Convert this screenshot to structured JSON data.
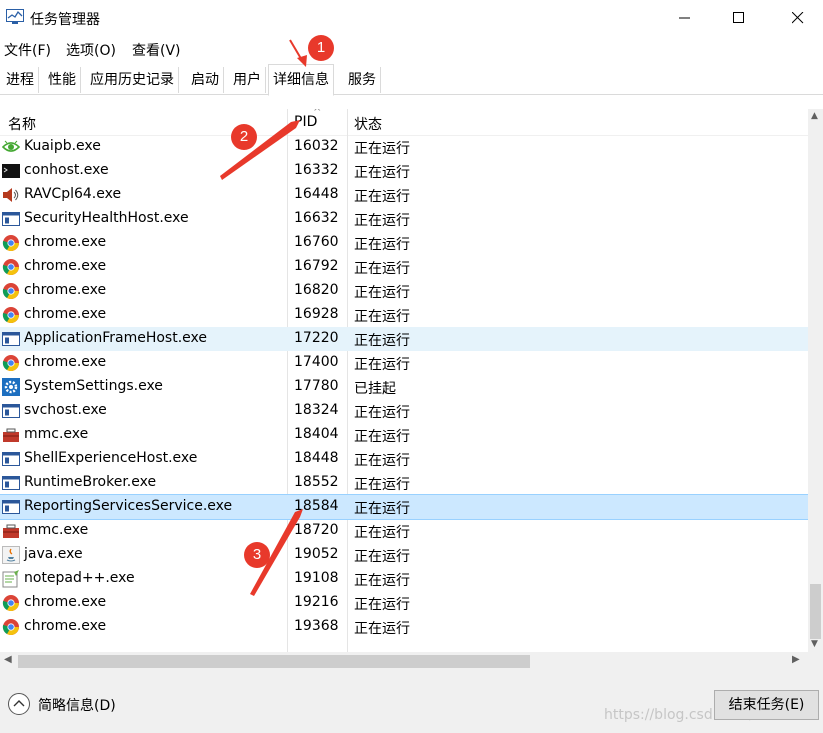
{
  "window": {
    "title": "任务管理器"
  },
  "menu": {
    "items": [
      "文件(F)",
      "选项(O)",
      "查看(V)"
    ]
  },
  "tabs": [
    "进程",
    "性能",
    "应用历史记录",
    "启动",
    "用户",
    "详细信息",
    "服务"
  ],
  "active_tab": "详细信息",
  "columns": {
    "name": "名称",
    "pid": "PID",
    "status": "状态"
  },
  "rows": [
    {
      "icon": "kuaipb-eye-icon",
      "name": "Kuaipb.exe",
      "pid": "16032",
      "status": "正在运行"
    },
    {
      "icon": "console-icon",
      "name": "conhost.exe",
      "pid": "16332",
      "status": "正在运行"
    },
    {
      "icon": "speaker-icon",
      "name": "RAVCpl64.exe",
      "pid": "16448",
      "status": "正在运行"
    },
    {
      "icon": "window-app-icon",
      "name": "SecurityHealthHost.exe",
      "pid": "16632",
      "status": "正在运行"
    },
    {
      "icon": "chrome-icon",
      "name": "chrome.exe",
      "pid": "16760",
      "status": "正在运行"
    },
    {
      "icon": "chrome-icon",
      "name": "chrome.exe",
      "pid": "16792",
      "status": "正在运行"
    },
    {
      "icon": "chrome-icon",
      "name": "chrome.exe",
      "pid": "16820",
      "status": "正在运行"
    },
    {
      "icon": "chrome-icon",
      "name": "chrome.exe",
      "pid": "16928",
      "status": "正在运行"
    },
    {
      "icon": "window-app-icon",
      "name": "ApplicationFrameHost.exe",
      "pid": "17220",
      "status": "正在运行"
    },
    {
      "icon": "chrome-icon",
      "name": "chrome.exe",
      "pid": "17400",
      "status": "正在运行"
    },
    {
      "icon": "gear-icon",
      "name": "SystemSettings.exe",
      "pid": "17780",
      "status": "已挂起"
    },
    {
      "icon": "window-app-icon",
      "name": "svchost.exe",
      "pid": "18324",
      "status": "正在运行"
    },
    {
      "icon": "toolbox-icon",
      "name": "mmc.exe",
      "pid": "18404",
      "status": "正在运行"
    },
    {
      "icon": "window-app-icon",
      "name": "ShellExperienceHost.exe",
      "pid": "18448",
      "status": "正在运行"
    },
    {
      "icon": "window-app-icon",
      "name": "RuntimeBroker.exe",
      "pid": "18552",
      "status": "正在运行"
    },
    {
      "icon": "window-app-icon",
      "name": "ReportingServicesService.exe",
      "pid": "18584",
      "status": "正在运行"
    },
    {
      "icon": "toolbox-icon",
      "name": "mmc.exe",
      "pid": "18720",
      "status": "正在运行"
    },
    {
      "icon": "java-icon",
      "name": "java.exe",
      "pid": "19052",
      "status": "正在运行"
    },
    {
      "icon": "notepadpp-icon",
      "name": "notepad++.exe",
      "pid": "19108",
      "status": "正在运行"
    },
    {
      "icon": "chrome-icon",
      "name": "chrome.exe",
      "pid": "19216",
      "status": "正在运行"
    },
    {
      "icon": "chrome-icon",
      "name": "chrome.exe",
      "pid": "19368",
      "status": "正在运行"
    }
  ],
  "hover_row": "ApplicationFrameHost.exe",
  "selected_row": "ReportingServicesService.exe",
  "footer": {
    "less_info": "简略信息(D)",
    "end_task": "结束任务(E)",
    "watermark": "https://blog.csdn.net/DDDDD"
  },
  "annotations": [
    "1",
    "2",
    "3"
  ],
  "colors": {
    "annotation": "#e8392b",
    "selected": "#cce8ff",
    "hover": "#e5f3fb"
  }
}
